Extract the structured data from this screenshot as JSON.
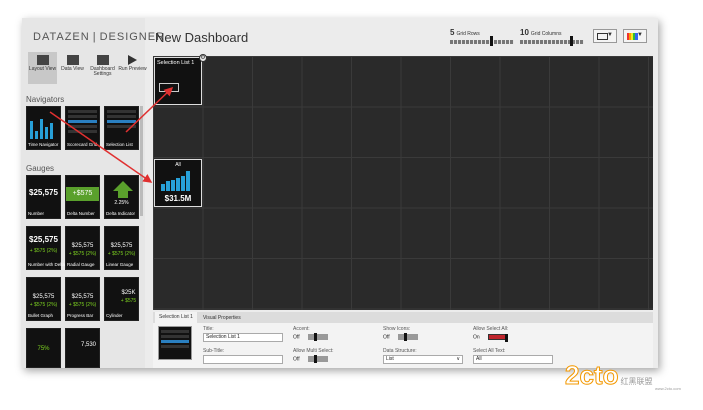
{
  "app": {
    "brand_left": "DATAZEN",
    "brand_right": "DESIGNER"
  },
  "toolbar": [
    {
      "label": "Layout View",
      "icon": "layout-icon",
      "active": true
    },
    {
      "label": "Data View",
      "icon": "data-icon",
      "active": false
    },
    {
      "label": "Dashboard Settings",
      "icon": "settings-icon",
      "active": false
    },
    {
      "label": "Run Preview",
      "icon": "play-icon",
      "active": false
    }
  ],
  "navigators": {
    "title": "Navigators",
    "items": [
      "Time Navigator",
      "Scorecard Grid",
      "Selection List"
    ]
  },
  "gauges": {
    "title": "Gauges",
    "items": [
      {
        "caption": "Number",
        "value": "$25,575"
      },
      {
        "caption": "Delta Number",
        "value": "+$575"
      },
      {
        "caption": "Delta Indicator",
        "value": "2.25%"
      },
      {
        "caption": "Number with Delta",
        "value": "$25,575",
        "sub": "+ $575 (2%)"
      },
      {
        "caption": "Radial Gauge",
        "value": "$25,575",
        "sub": "+ $575 (2%)"
      },
      {
        "caption": "Linear Gauge",
        "value": "$25,575",
        "sub": "+ $575 (2%)"
      },
      {
        "caption": "Bullet Graph",
        "value": "$25,575",
        "sub": "+ $575 (2%)"
      },
      {
        "caption": "Progress Bar",
        "value": "$25,575",
        "sub": "+ $575 (2%)"
      },
      {
        "caption": "Cylinder",
        "value": "$25K",
        "sub": "+ $575"
      },
      {
        "caption": "",
        "value": "75%"
      },
      {
        "caption": "",
        "value": "7,530"
      }
    ]
  },
  "header": {
    "title": "New Dashboard",
    "grid_rows": {
      "value": "5",
      "label": "Grid Rows"
    },
    "grid_columns": {
      "value": "10",
      "label": "Grid Columns"
    }
  },
  "canvas": {
    "selection_widget": {
      "title": "Selection List 1"
    },
    "chart_widget": {
      "title": "All",
      "value": "$31.5M"
    }
  },
  "properties": {
    "tabs": [
      "Selection List 1",
      "Visual Properties"
    ],
    "title_label": "Title:",
    "title_value": "Selection List 1",
    "subtitle_label": "Sub-Title:",
    "subtitle_value": "",
    "accent_label": "Accent:",
    "accent_value": "Off",
    "allow_multi_label": "Allow Multi Select:",
    "allow_multi_value": "Off",
    "show_icons_label": "Show Icons:",
    "show_icons_value": "Off",
    "data_structure_label": "Data Structure:",
    "data_structure_value": "List",
    "allow_select_all_label": "Allow Select All:",
    "allow_select_all_value": "On",
    "select_all_text_label": "Select All Text:",
    "select_all_text_value": "All"
  },
  "watermark": {
    "logo": "2cto",
    "cn": "红黑联盟",
    "domain": "www.2cto.com"
  },
  "colors": {
    "accent_blue": "#27a0d8",
    "green": "#5aa02c",
    "red_arrow": "#e03030",
    "switch_on": "#c0262d"
  }
}
